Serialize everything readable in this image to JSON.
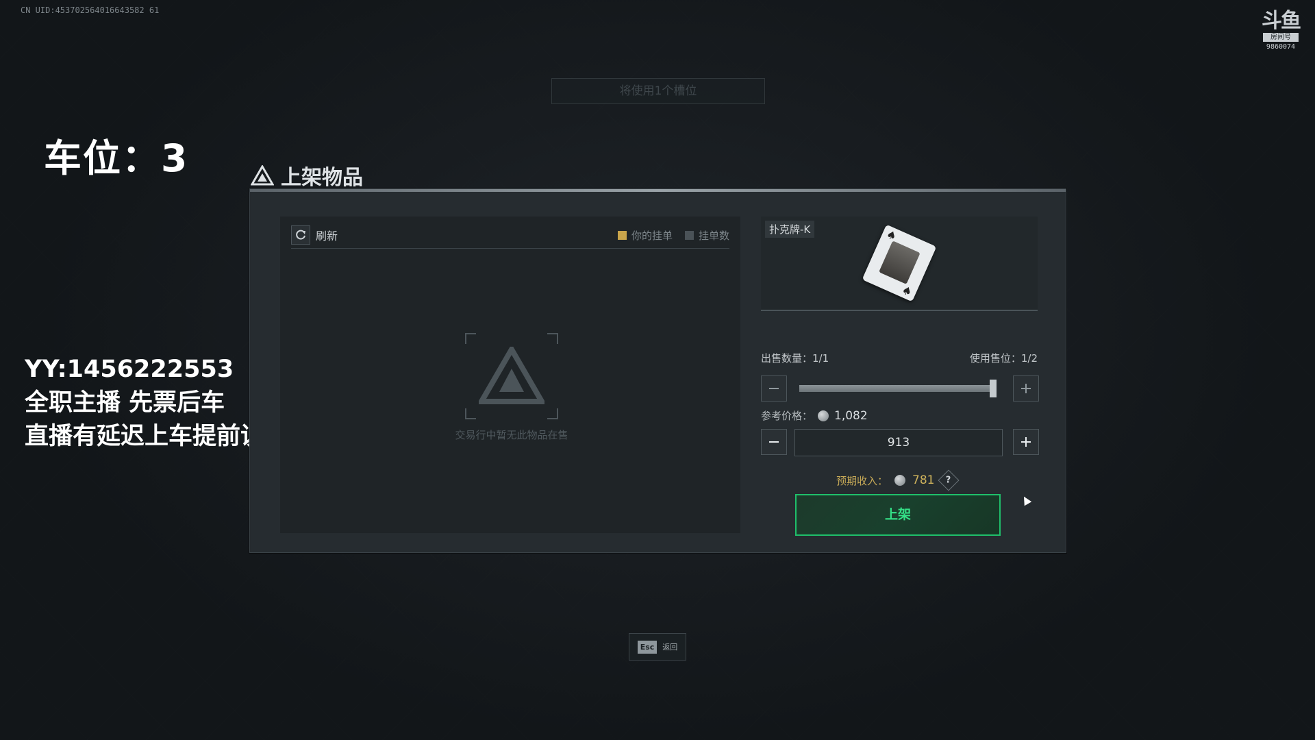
{
  "stream": {
    "uid": "CN UID:453702564016643582 61",
    "logo_mark": "斗鱼",
    "logo_sub": "房间号",
    "room_number": "9860074",
    "slot_label": "车位：3",
    "overlay_lines": [
      "YY:1456222553",
      "全职主播 先票后车",
      "直播有延迟上车提前说"
    ]
  },
  "slot_hint": "将使用1个槽位",
  "dialog": {
    "title": "上架物品",
    "refresh_label": "刷新",
    "legend": [
      {
        "label": "你的挂单",
        "color": "#c9a54b"
      },
      {
        "label": "挂单数",
        "color": "#4a5257"
      }
    ],
    "empty_text": "交易行中暂无此物品在售",
    "item_name": "扑克牌-K",
    "sell_qty_label": "出售数量：1/1",
    "slots_label": "使用售位：1/2",
    "slider_fraction": 1.0,
    "ref_price_label": "参考价格：",
    "ref_price_value": "1,082",
    "price_value": "913",
    "income_label": "预期收入：",
    "income_value": "781",
    "help_glyph": "?",
    "submit_label": "上架"
  },
  "footer": {
    "esc_key": "Esc",
    "esc_label": "返回"
  },
  "colors": {
    "accent_green": "#1fbf6a",
    "gold": "#c7aa57"
  }
}
